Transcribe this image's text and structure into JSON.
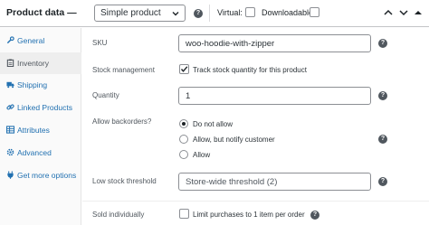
{
  "header": {
    "title": "Product data —",
    "product_type": "Simple product",
    "virtual_label": "Virtual:",
    "downloadable_label": "Downloadable:"
  },
  "sidebar": {
    "items": [
      {
        "label": "General",
        "icon": "wrench-icon"
      },
      {
        "label": "Inventory",
        "icon": "clipboard-icon",
        "active": true
      },
      {
        "label": "Shipping",
        "icon": "truck-icon"
      },
      {
        "label": "Linked Products",
        "icon": "link-icon"
      },
      {
        "label": "Attributes",
        "icon": "table-icon"
      },
      {
        "label": "Advanced",
        "icon": "gear-icon"
      },
      {
        "label": "Get more options",
        "icon": "plugin-icon"
      }
    ]
  },
  "inventory": {
    "sku_label": "SKU",
    "sku_value": "woo-hoodie-with-zipper",
    "stock_management_label": "Stock management",
    "track_stock_label": "Track stock quantity for this product",
    "track_stock_checked": true,
    "quantity_label": "Quantity",
    "quantity_value": "1",
    "backorders_label": "Allow backorders?",
    "backorder_options": [
      {
        "label": "Do not allow",
        "selected": true
      },
      {
        "label": "Allow, but notify customer",
        "selected": false
      },
      {
        "label": "Allow",
        "selected": false
      }
    ],
    "low_stock_label": "Low stock threshold",
    "low_stock_placeholder": "Store-wide threshold (2)",
    "sold_individually_label": "Sold individually",
    "sold_individually_text": "Limit purchases to 1 item per order",
    "sold_individually_checked": false
  },
  "colors": {
    "link": "#2271b1",
    "text": "#1d2327",
    "muted": "#50575e",
    "border": "#8c8f94",
    "sidebar_bg": "#fafafa",
    "active_bg": "#eeeeee"
  }
}
